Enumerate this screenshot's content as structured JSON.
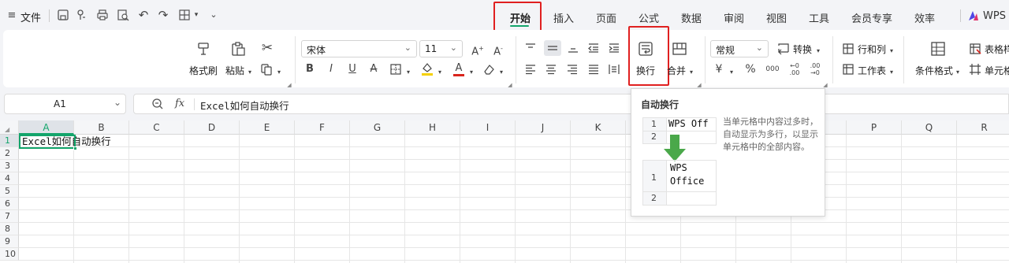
{
  "quick_access": {
    "menu_label": "文件",
    "icons": [
      "hamburger-menu-icon",
      "save-icon",
      "share-icon",
      "print-icon",
      "print-preview-icon",
      "undo-icon",
      "redo-icon",
      "view-toggle-icon",
      "chevron-down-icon"
    ]
  },
  "tabs": [
    {
      "label": "开始",
      "active": true
    },
    {
      "label": "插入"
    },
    {
      "label": "页面"
    },
    {
      "label": "公式"
    },
    {
      "label": "数据"
    },
    {
      "label": "审阅"
    },
    {
      "label": "视图"
    },
    {
      "label": "工具"
    },
    {
      "label": "会员专享"
    },
    {
      "label": "效率"
    },
    {
      "label": "WPS A"
    }
  ],
  "ribbon": {
    "format_painter": "格式刷",
    "paste": "粘贴",
    "font_name": "宋体",
    "font_size": "11",
    "wrap": "换行",
    "merge": "合并",
    "number_format": "常规",
    "convert": "转换",
    "rows_cols": "行和列",
    "worksheet": "工作表",
    "conditional_format": "条件格式",
    "table_style": "表格样",
    "cell": "单元格",
    "bold": "B",
    "italic": "I",
    "underline": "U",
    "strike": "A",
    "font_color_letter": "A",
    "percent": "%",
    "thousands": "000",
    "accent_green": "#13a56b",
    "highlight_red": "#e02020"
  },
  "formula_bar": {
    "cell_ref": "A1",
    "fx": "fx",
    "content": "Excel如何自动换行"
  },
  "sheet": {
    "columns": [
      "A",
      "B",
      "C",
      "D",
      "E",
      "F",
      "G",
      "H",
      "I",
      "J",
      "K",
      "L",
      "M",
      "N",
      "O",
      "P",
      "Q",
      "R"
    ],
    "rows": [
      "1",
      "2",
      "3",
      "4",
      "5",
      "6",
      "7",
      "8",
      "9",
      "10"
    ],
    "cell_a1": "Excel如何自动换行"
  },
  "tooltip": {
    "title": "自动换行",
    "description": "当单元格中内容过多时，自动显示为多行，以显示单元格中的全部内容。",
    "before_row1_num": "1",
    "before_row1_text": "WPS Off",
    "before_row2_num": "2",
    "after_row1_num": "1",
    "after_line1": "WPS",
    "after_line2": "Office",
    "after_row2_num": "2"
  }
}
